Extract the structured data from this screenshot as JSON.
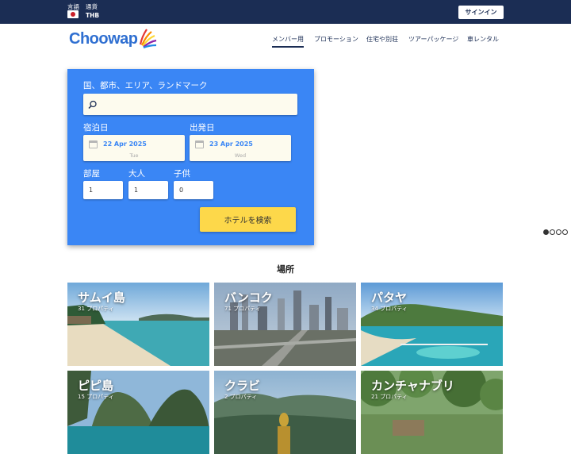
{
  "topbar": {
    "language_label": "言語",
    "currency_label": "通貨",
    "currency": "THB",
    "signin": "サインイン"
  },
  "logo": {
    "text": "Choowap"
  },
  "nav": [
    "メンバー用",
    "プロモーション",
    "住宅や別荘",
    "ツアーパッケージ",
    "車レンタル"
  ],
  "search": {
    "destination_label": "国、都市、エリア、ランドマーク",
    "destination_value": "",
    "checkin_label": "宿泊日",
    "checkout_label": "出発日",
    "checkin_date": "22 Apr 2025",
    "checkin_weekday": "Tue",
    "checkout_date": "23 Apr 2025",
    "checkout_weekday": "Wed",
    "rooms_label": "部屋",
    "adults_label": "大人",
    "children_label": "子供",
    "rooms": "1",
    "adults": "1",
    "children": "0",
    "button": "ホテルを検索"
  },
  "places_title": "場所",
  "places": [
    {
      "name": "サムイ島",
      "count": "31 プロパティ"
    },
    {
      "name": "バンコク",
      "count": "71 プロパティ"
    },
    {
      "name": "パタヤ",
      "count": "34 プロパティ"
    },
    {
      "name": "ピピ島",
      "count": "15 プロパティ"
    },
    {
      "name": "クラビ",
      "count": "2 プロパティ"
    },
    {
      "name": "カンチャナブリ",
      "count": "21 プロパティ"
    }
  ],
  "colors": {
    "topbar": "#1b2d54",
    "search_panel": "#3a86f5",
    "search_button": "#fdd84a",
    "logo": "#2f6fd1"
  }
}
